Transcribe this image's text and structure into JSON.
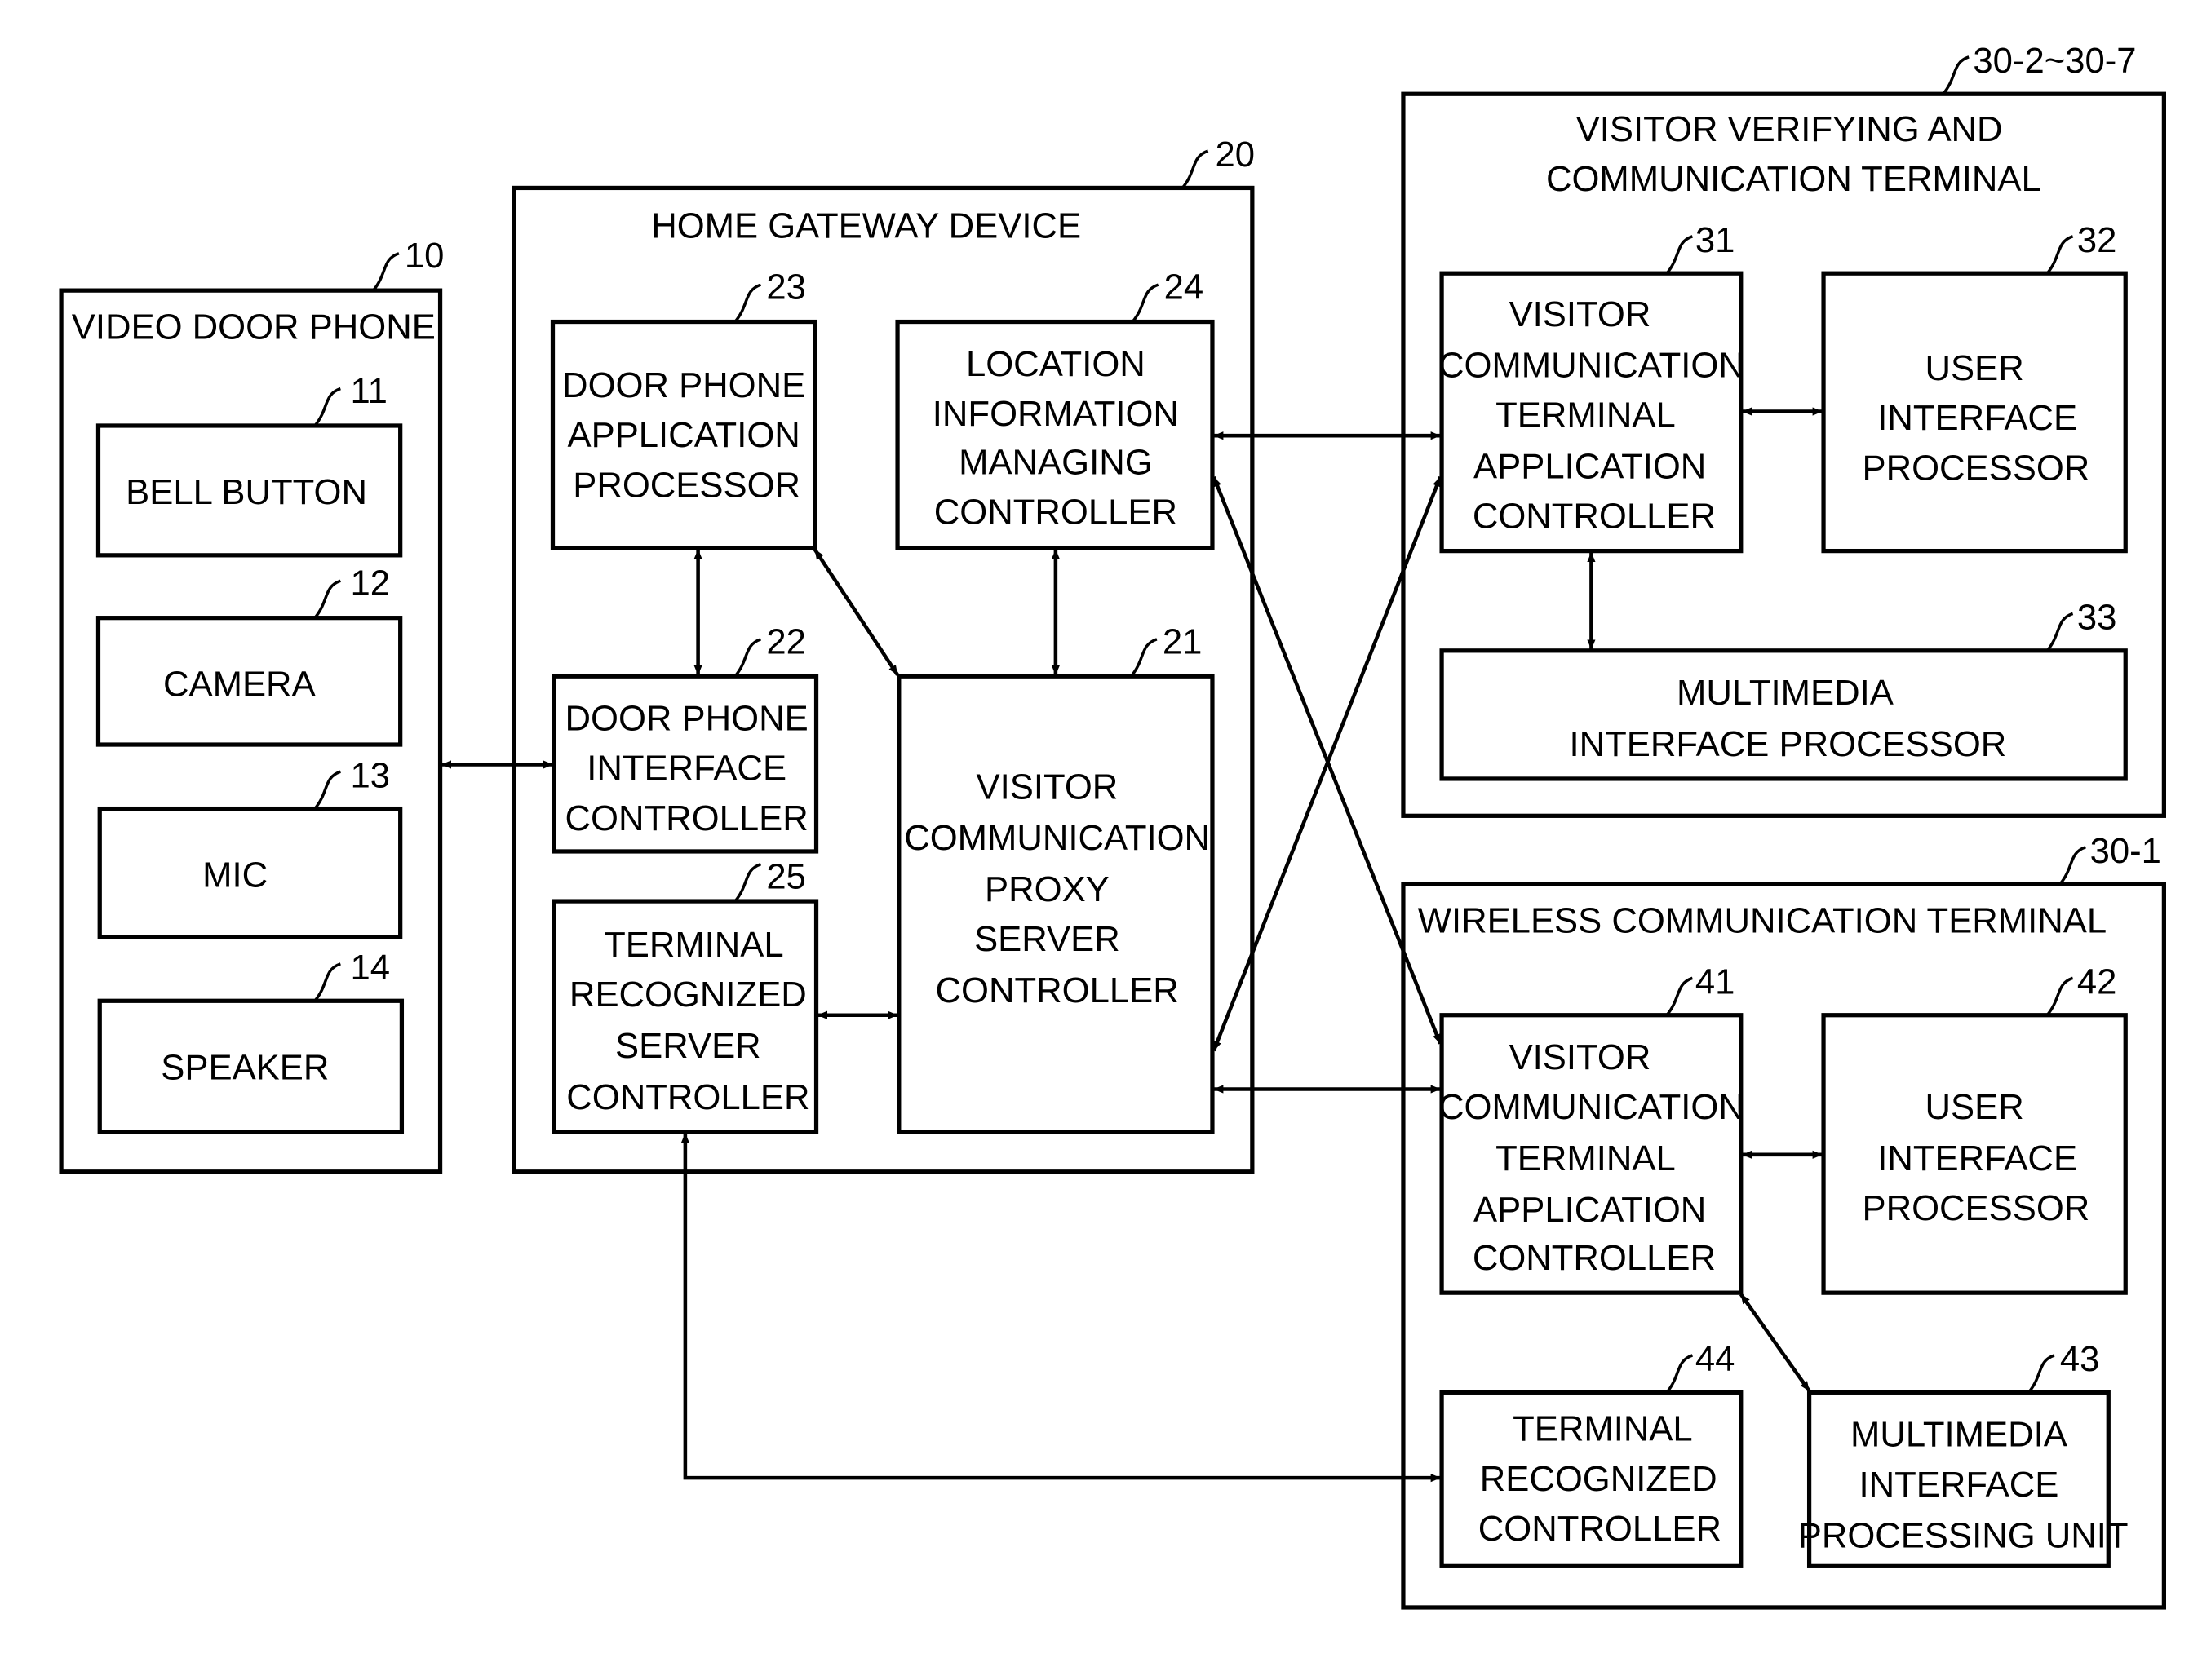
{
  "figure": {
    "video_door_phone": {
      "ref": "10",
      "title": "VIDEO DOOR PHONE",
      "components": [
        {
          "ref": "11",
          "label": [
            "BELL BUTTON"
          ]
        },
        {
          "ref": "12",
          "label": [
            "CAMERA"
          ]
        },
        {
          "ref": "13",
          "label": [
            "MIC"
          ]
        },
        {
          "ref": "14",
          "label": [
            "SPEAKER"
          ]
        }
      ]
    },
    "home_gateway": {
      "ref": "20",
      "title": "HOME GATEWAY DEVICE",
      "components": {
        "door_phone_app_processor": {
          "ref": "23",
          "label": [
            "DOOR PHONE",
            "APPLICATION",
            "PROCESSOR"
          ]
        },
        "location_info_controller": {
          "ref": "24",
          "label": [
            "LOCATION",
            "INFORMATION",
            "MANAGING",
            "CONTROLLER"
          ]
        },
        "door_phone_interface_controller": {
          "ref": "22",
          "label": [
            "DOOR PHONE",
            "INTERFACE",
            "CONTROLLER"
          ]
        },
        "terminal_recognized_server_controller": {
          "ref": "25",
          "label": [
            "TERMINAL",
            "RECOGNIZED",
            "SERVER",
            "CONTROLLER"
          ]
        },
        "visitor_comm_proxy_server_controller": {
          "ref": "21",
          "label": [
            "VISITOR",
            "COMMUNICATION",
            "PROXY",
            "SERVER",
            "CONTROLLER"
          ]
        }
      }
    },
    "visitor_verifying_terminal": {
      "ref": "30-2~30-7",
      "title": [
        "VISITOR VERIFYING AND",
        "COMMUNICATION TERMINAL"
      ],
      "components": {
        "app_controller": {
          "ref": "31",
          "label": [
            "VISITOR",
            "COMMUNICATION",
            "TERMINAL",
            "APPLICATION",
            "CONTROLLER"
          ]
        },
        "ui_processor": {
          "ref": "32",
          "label": [
            "USER",
            "INTERFACE",
            "PROCESSOR"
          ]
        },
        "multimedia_processor": {
          "ref": "33",
          "label": [
            "MULTIMEDIA",
            "INTERFACE PROCESSOR"
          ]
        }
      }
    },
    "wireless_terminal": {
      "ref": "30-1",
      "title": "WIRELESS COMMUNICATION TERMINAL",
      "components": {
        "app_controller": {
          "ref": "41",
          "label": [
            "VISITOR",
            "COMMUNICATION",
            "TERMINAL",
            "APPLICATION",
            "CONTROLLER"
          ]
        },
        "ui_processor": {
          "ref": "42",
          "label": [
            "USER",
            "INTERFACE",
            "PROCESSOR"
          ]
        },
        "multimedia_unit": {
          "ref": "43",
          "label": [
            "MULTIMEDIA",
            "INTERFACE",
            "PROCESSING UNIT"
          ]
        },
        "terminal_recognized_controller": {
          "ref": "44",
          "label": [
            "TERMINAL",
            "RECOGNIZED",
            "CONTROLLER"
          ]
        }
      }
    },
    "connections": [
      {
        "from": "10",
        "to": "22",
        "type": "bidirectional"
      },
      {
        "from": "23",
        "to": "22",
        "type": "bidirectional"
      },
      {
        "from": "23",
        "to": "21",
        "type": "bidirectional"
      },
      {
        "from": "24",
        "to": "21",
        "type": "bidirectional"
      },
      {
        "from": "25",
        "to": "21",
        "type": "bidirectional"
      },
      {
        "from": "24",
        "to": "31",
        "type": "bidirectional"
      },
      {
        "from": "24",
        "to": "41",
        "type": "bidirectional"
      },
      {
        "from": "21",
        "to": "31",
        "type": "bidirectional"
      },
      {
        "from": "21",
        "to": "41",
        "type": "bidirectional"
      },
      {
        "from": "25",
        "to": "44",
        "type": "bidirectional"
      },
      {
        "from": "31",
        "to": "32",
        "type": "bidirectional"
      },
      {
        "from": "31",
        "to": "33",
        "type": "bidirectional"
      },
      {
        "from": "41",
        "to": "42",
        "type": "bidirectional"
      },
      {
        "from": "41",
        "to": "43",
        "type": "bidirectional"
      }
    ]
  }
}
